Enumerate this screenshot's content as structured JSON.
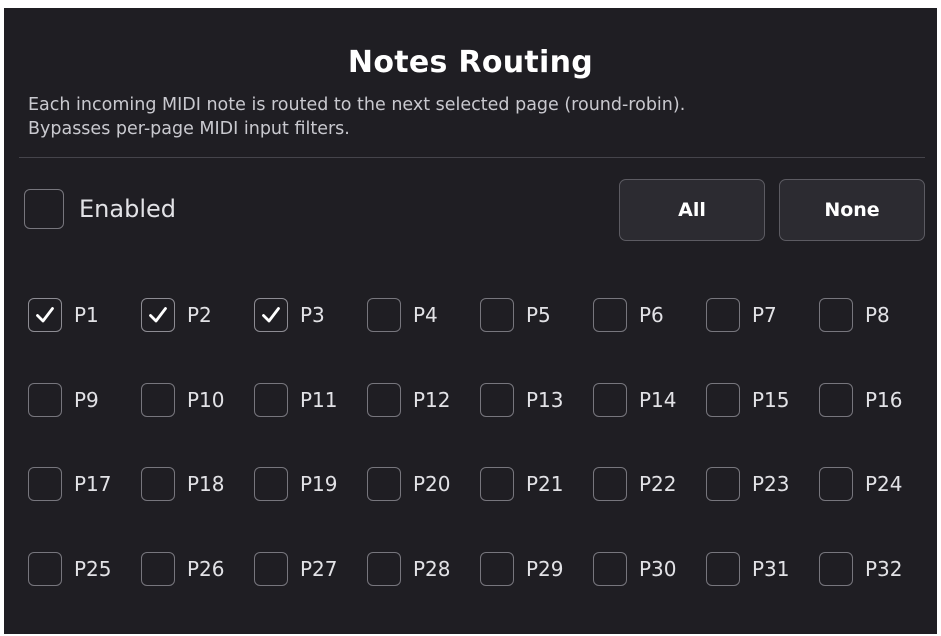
{
  "dialog": {
    "title": "Notes Routing",
    "description_lines": [
      "Each incoming MIDI note is routed to the next selected page (round-robin).",
      "Bypasses per-page MIDI input filters."
    ]
  },
  "enabled": {
    "label": "Enabled",
    "checked": false
  },
  "buttons": {
    "all_label": "All",
    "none_label": "None"
  },
  "pages": [
    {
      "label": "P1",
      "checked": true
    },
    {
      "label": "P2",
      "checked": true
    },
    {
      "label": "P3",
      "checked": true
    },
    {
      "label": "P4",
      "checked": false
    },
    {
      "label": "P5",
      "checked": false
    },
    {
      "label": "P6",
      "checked": false
    },
    {
      "label": "P7",
      "checked": false
    },
    {
      "label": "P8",
      "checked": false
    },
    {
      "label": "P9",
      "checked": false
    },
    {
      "label": "P10",
      "checked": false
    },
    {
      "label": "P11",
      "checked": false
    },
    {
      "label": "P12",
      "checked": false
    },
    {
      "label": "P13",
      "checked": false
    },
    {
      "label": "P14",
      "checked": false
    },
    {
      "label": "P15",
      "checked": false
    },
    {
      "label": "P16",
      "checked": false
    },
    {
      "label": "P17",
      "checked": false
    },
    {
      "label": "P18",
      "checked": false
    },
    {
      "label": "P19",
      "checked": false
    },
    {
      "label": "P20",
      "checked": false
    },
    {
      "label": "P21",
      "checked": false
    },
    {
      "label": "P22",
      "checked": false
    },
    {
      "label": "P23",
      "checked": false
    },
    {
      "label": "P24",
      "checked": false
    },
    {
      "label": "P25",
      "checked": false
    },
    {
      "label": "P26",
      "checked": false
    },
    {
      "label": "P27",
      "checked": false
    },
    {
      "label": "P28",
      "checked": false
    },
    {
      "label": "P29",
      "checked": false
    },
    {
      "label": "P30",
      "checked": false
    },
    {
      "label": "P31",
      "checked": false
    },
    {
      "label": "P32",
      "checked": false
    }
  ],
  "colors": {
    "panel_background": "#1f1e23",
    "button_background": "#2c2b31",
    "checkbox_border": "#77767d",
    "checkmark": "#ffffff"
  }
}
